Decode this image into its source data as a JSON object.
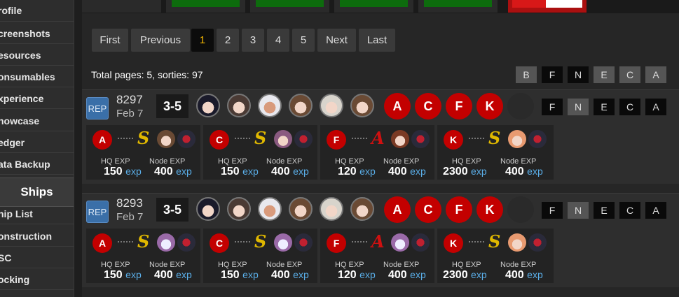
{
  "sidebar": {
    "items": [
      "rofile",
      "creenshots",
      "esources",
      "onsumables",
      "xperience",
      "howcase",
      "edger",
      "ata Backup"
    ],
    "section": "Ships",
    "items2": [
      "hip List",
      "onstruction",
      "SC",
      "ocking"
    ]
  },
  "pager": {
    "buttons": [
      "First",
      "Previous",
      "1",
      "2",
      "3",
      "4",
      "5",
      "Next",
      "Last"
    ],
    "active": "1"
  },
  "summary": "Total pages: 5, sorties: 97",
  "filters": [
    "B",
    "F",
    "N",
    "E",
    "C",
    "A"
  ],
  "sorties": [
    {
      "replay": "REP",
      "id": "8297",
      "date": "Feb 7",
      "map": "3-5",
      "nodes": [
        "A",
        "C",
        "F",
        "K"
      ],
      "row_filters": [
        "F",
        "N",
        "E",
        "C",
        "A"
      ],
      "cards": [
        {
          "node": "A",
          "rank": "S",
          "hq_label": "HQ EXP",
          "hq": "150",
          "node_label": "Node EXP",
          "nexp": "400",
          "unit": "exp"
        },
        {
          "node": "C",
          "rank": "S",
          "hq_label": "HQ EXP",
          "hq": "150",
          "node_label": "Node EXP",
          "nexp": "400",
          "unit": "exp"
        },
        {
          "node": "F",
          "rank": "A",
          "hq_label": "HQ EXP",
          "hq": "120",
          "node_label": "Node EXP",
          "nexp": "400",
          "unit": "exp"
        },
        {
          "node": "K",
          "rank": "S",
          "hq_label": "HQ EXP",
          "hq": "2300",
          "node_label": "Node EXP",
          "nexp": "400",
          "unit": "exp"
        }
      ]
    },
    {
      "replay": "REP",
      "id": "8293",
      "date": "Feb 7",
      "map": "3-5",
      "nodes": [
        "A",
        "C",
        "F",
        "K"
      ],
      "row_filters": [
        "F",
        "N",
        "E",
        "C",
        "A"
      ],
      "cards": [
        {
          "node": "A",
          "rank": "S",
          "hq_label": "HQ EXP",
          "hq": "150",
          "node_label": "Node EXP",
          "nexp": "400",
          "unit": "exp"
        },
        {
          "node": "C",
          "rank": "S",
          "hq_label": "HQ EXP",
          "hq": "150",
          "node_label": "Node EXP",
          "nexp": "400",
          "unit": "exp"
        },
        {
          "node": "F",
          "rank": "A",
          "hq_label": "HQ EXP",
          "hq": "120",
          "node_label": "Node EXP",
          "nexp": "400",
          "unit": "exp"
        },
        {
          "node": "K",
          "rank": "S",
          "hq_label": "HQ EXP",
          "hq": "2300",
          "node_label": "Node EXP",
          "nexp": "400",
          "unit": "exp"
        }
      ]
    }
  ],
  "colors": {
    "node_red": "#c30000",
    "rank_s": "#e0b800",
    "rank_a": "#d01010",
    "exp_blue": "#5aaee8",
    "active_page": "#f0b400"
  }
}
